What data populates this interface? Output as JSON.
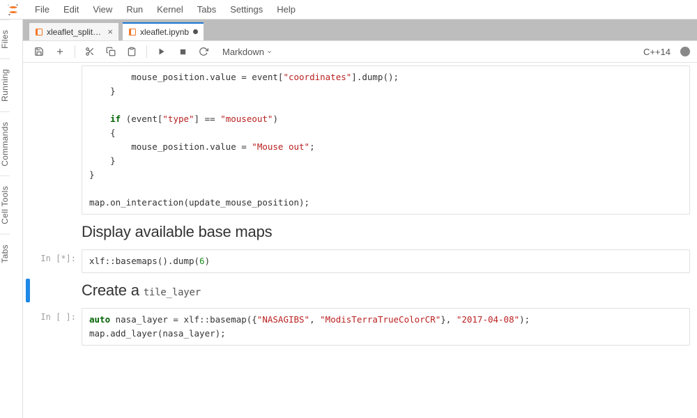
{
  "menu": {
    "items": [
      "File",
      "Edit",
      "View",
      "Run",
      "Kernel",
      "Tabs",
      "Settings",
      "Help"
    ]
  },
  "leftRail": {
    "tabs": [
      "Files",
      "Running",
      "Commands",
      "Cell Tools",
      "Tabs"
    ]
  },
  "tabs": {
    "items": [
      {
        "label": "xleaflet_split_m",
        "active": false,
        "dirty": false
      },
      {
        "label": "xleaflet.ipynb",
        "active": true,
        "dirty": true
      }
    ]
  },
  "toolbar": {
    "cellType": "Markdown",
    "kernel": "C++14"
  },
  "cells": [
    {
      "kind": "code",
      "prompt": "",
      "active": false,
      "code": [
        {
          "indent": 8,
          "tokens": [
            {
              "t": "mouse_position.value = event["
            },
            {
              "t": "\"coordinates\"",
              "cls": "tok-str"
            },
            {
              "t": "].dump();"
            }
          ]
        },
        {
          "indent": 4,
          "tokens": [
            {
              "t": "}"
            }
          ]
        },
        {
          "indent": 0,
          "tokens": [
            {
              "t": ""
            }
          ]
        },
        {
          "indent": 4,
          "tokens": [
            {
              "t": "if",
              "cls": "tok-kw"
            },
            {
              "t": " (event["
            },
            {
              "t": "\"type\"",
              "cls": "tok-str"
            },
            {
              "t": "] == "
            },
            {
              "t": "\"mouseout\"",
              "cls": "tok-str"
            },
            {
              "t": ")"
            }
          ]
        },
        {
          "indent": 4,
          "tokens": [
            {
              "t": "{"
            }
          ]
        },
        {
          "indent": 8,
          "tokens": [
            {
              "t": "mouse_position.value = "
            },
            {
              "t": "\"Mouse out\"",
              "cls": "tok-str"
            },
            {
              "t": ";"
            }
          ]
        },
        {
          "indent": 4,
          "tokens": [
            {
              "t": "}"
            }
          ]
        },
        {
          "indent": 0,
          "tokens": [
            {
              "t": "}"
            }
          ]
        },
        {
          "indent": 0,
          "tokens": [
            {
              "t": ""
            }
          ]
        },
        {
          "indent": 0,
          "tokens": [
            {
              "t": "map.on_interaction(update_mouse_position);"
            }
          ]
        }
      ]
    },
    {
      "kind": "markdown",
      "active": false,
      "heading": "Display available base maps"
    },
    {
      "kind": "code",
      "prompt": "In [*]:",
      "active": false,
      "code": [
        {
          "indent": 0,
          "tokens": [
            {
              "t": "xlf::basemaps().dump("
            },
            {
              "t": "6",
              "cls": "tok-num"
            },
            {
              "t": ")"
            }
          ]
        }
      ]
    },
    {
      "kind": "markdown",
      "active": true,
      "heading": "Create a ",
      "heading_code": "tile_layer"
    },
    {
      "kind": "code",
      "prompt": "In [ ]:",
      "active": false,
      "code": [
        {
          "indent": 0,
          "tokens": [
            {
              "t": "auto",
              "cls": "tok-kw"
            },
            {
              "t": " nasa_layer = xlf::basemap({"
            },
            {
              "t": "\"NASAGIBS\"",
              "cls": "tok-str"
            },
            {
              "t": ", "
            },
            {
              "t": "\"ModisTerraTrueColorCR\"",
              "cls": "tok-str"
            },
            {
              "t": "}, "
            },
            {
              "t": "\"2017-04-08\"",
              "cls": "tok-str"
            },
            {
              "t": ");"
            }
          ]
        },
        {
          "indent": 0,
          "tokens": [
            {
              "t": "map.add_layer(nasa_layer);"
            }
          ]
        }
      ]
    }
  ],
  "icons": {
    "save": "save-icon",
    "add": "plus-icon",
    "cut": "scissors-icon",
    "copy": "copy-icon",
    "paste": "clipboard-icon",
    "run": "play-icon",
    "stop": "stop-icon",
    "restart": "refresh-icon",
    "chevronDown": "chevron-down-icon",
    "close": "close-icon"
  }
}
